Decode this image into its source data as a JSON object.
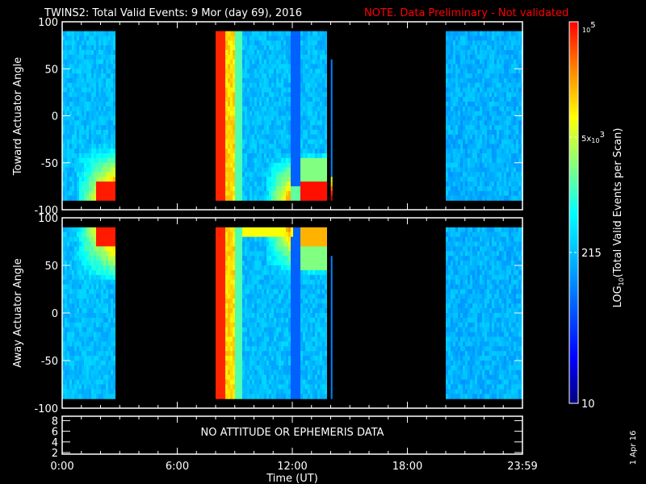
{
  "title": {
    "main": "TWINS2: Total Valid Events:  9 Mor (day  69), 2016",
    "note": "NOTE. Data Preliminary - Not validated",
    "note_color": "#ff0000"
  },
  "chart_data": [
    {
      "type": "heatmap",
      "name": "toward",
      "ylabel": "Toward Actuator Angle",
      "ylim": [
        -100,
        100
      ],
      "yticks": [
        "100",
        "50",
        "0",
        "-50",
        "-100"
      ],
      "data_angle_range": [
        -90,
        90
      ],
      "xlim_hours": [
        0,
        24
      ],
      "segments_hours": [
        [
          0,
          2.7
        ],
        [
          8.0,
          13.8
        ],
        [
          20.0,
          24.0
        ]
      ],
      "spike": {
        "hour": 14.05,
        "angle_range": [
          -90,
          60
        ]
      },
      "enhanced_side": "low-angle"
    },
    {
      "type": "heatmap",
      "name": "away",
      "ylabel": "Away Actuator Angle",
      "ylim": [
        -100,
        100
      ],
      "yticks": [
        "100",
        "50",
        "0",
        "-50",
        "-100"
      ],
      "data_angle_range": [
        -90,
        90
      ],
      "xlim_hours": [
        0,
        24
      ],
      "segments_hours": [
        [
          0,
          2.7
        ],
        [
          8.0,
          13.8
        ],
        [
          20.0,
          24.0
        ]
      ],
      "spike": {
        "hour": 14.05,
        "angle_range": [
          -90,
          60
        ]
      },
      "enhanced_side": "high-angle"
    },
    {
      "type": "line",
      "name": "ephemeris",
      "yticks": [
        "8",
        "6",
        "4",
        "2"
      ],
      "message": "NO ATTITUDE OR EPHEMERIS DATA"
    }
  ],
  "xaxis": {
    "label": "Time (UT)",
    "ticks": [
      "0:00",
      "6:00",
      "12:00",
      "18:00",
      "23:59"
    ]
  },
  "colorbar": {
    "label": "LOG10(Total Valid Events per Scan)",
    "label_main": "LOG",
    "label_sub": "10",
    "label_rest": "(Total Valid Events per Scan)",
    "range": [
      10,
      100000
    ],
    "ticks": {
      "top_base": "10",
      "top_exp": "5",
      "mid_pre": "5x",
      "mid_base": "10",
      "mid_exp": "3",
      "low": "215",
      "bottom": "10"
    }
  },
  "footer_date": "1 Apr 16"
}
